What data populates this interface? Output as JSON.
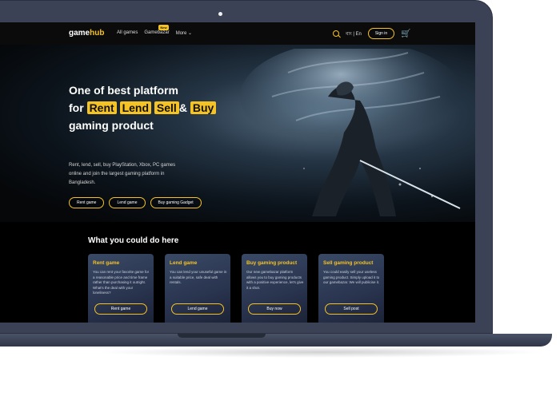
{
  "brand": {
    "logo_game": "game",
    "logo_hub": "hub"
  },
  "nav": {
    "links": [
      "All games",
      "Gamebazar",
      "More ⌄"
    ],
    "new_badge": "New",
    "lang": "বাং | En",
    "signin": "Sign in"
  },
  "hero": {
    "title_line1": "One of best platform",
    "title_for": "for",
    "tags": [
      "Rent",
      "Lend",
      "Sell",
      "Buy"
    ],
    "amp": "&",
    "title_line3": "gaming product",
    "description": "Rent, lend, sell, buy PlayStation, Xbox, PC games online and join the largest gaming platform in Bangladesh.",
    "buttons": [
      "Rent game",
      "Lend game",
      "Buy gaming Gadget"
    ]
  },
  "services": {
    "title": "What you could do here",
    "cards": [
      {
        "title": "Rent game",
        "text": "You can rent your favorite game for a reasonable price and time frame rather than purchasing it outright. What's the deal with your loneliness?",
        "button": "Rent game"
      },
      {
        "title": "Lend game",
        "text": "You can lend your unuseful game in a suitable price, safe deal with rentals.",
        "button": "Lend game"
      },
      {
        "title": "Buy gaming product",
        "text": "Our new gamebazar platform allows you to buy gaming products with a positive experience, let's give it a shot.",
        "button": "Buy now"
      },
      {
        "title": "Sell gaming product",
        "text": "You could easily sell your useless gaming product. Simply upload it to our gamebazar. We will publicise it.",
        "button": "Sell post"
      }
    ]
  },
  "colors": {
    "accent": "#f6c324",
    "frame": "#3b4256"
  }
}
